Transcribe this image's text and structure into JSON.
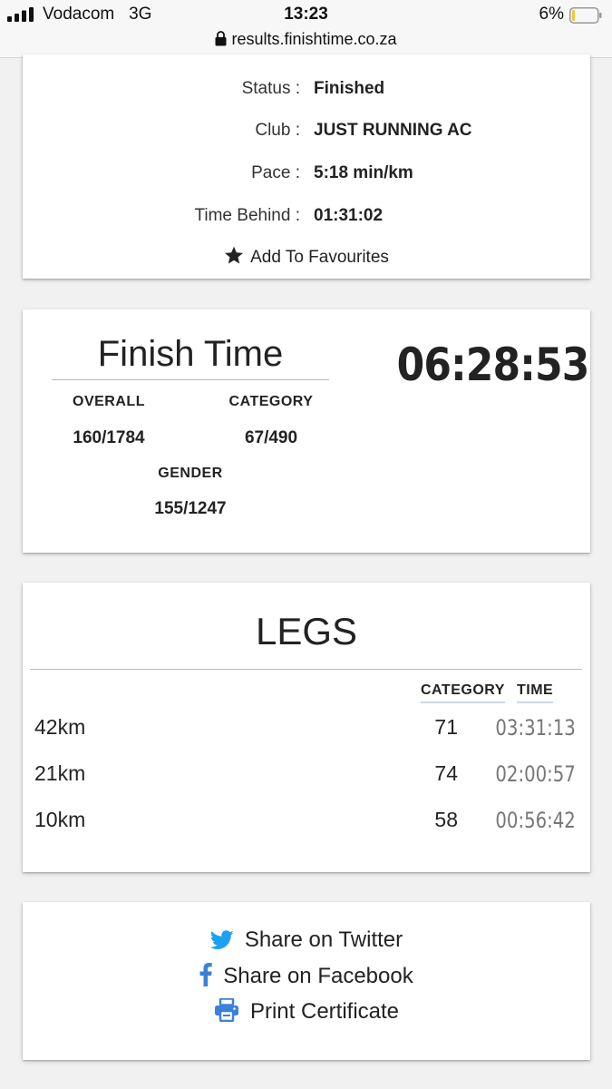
{
  "status_bar": {
    "carrier": "Vodacom",
    "network": "3G",
    "time": "13:23",
    "battery_percent": "6%"
  },
  "browser": {
    "url": "results.finishtime.co.za"
  },
  "details": {
    "rows": [
      {
        "label": "Status :",
        "value": "Finished"
      },
      {
        "label": "Club :",
        "value": "JUST RUNNING AC"
      },
      {
        "label": "Pace :",
        "value": "5:18 min/km"
      },
      {
        "label": "Time Behind :",
        "value": "01:31:02"
      }
    ],
    "favourites_label": "Add To Favourites"
  },
  "finish": {
    "title": "Finish Time",
    "time": "06:28:53",
    "overall_label": "OVERALL",
    "overall_value": "160/1784",
    "category_label": "CATEGORY",
    "category_value": "67/490",
    "gender_label": "GENDER",
    "gender_value": "155/1247"
  },
  "legs": {
    "title": "LEGS",
    "col_category": "CATEGORY",
    "col_time": "TIME",
    "rows": [
      {
        "name": "42km",
        "category": "71",
        "time": "03:31:13"
      },
      {
        "name": "21km",
        "category": "74",
        "time": "02:00:57"
      },
      {
        "name": "10km",
        "category": "58",
        "time": "00:56:42"
      }
    ]
  },
  "share": {
    "twitter_label": "Share on Twitter",
    "facebook_label": "Share on Facebook",
    "print_label": "Print Certificate"
  },
  "colors": {
    "accent_blue": "#3b82d6",
    "twitter_blue": "#1da1f2",
    "battery_low": "#f5c242"
  }
}
